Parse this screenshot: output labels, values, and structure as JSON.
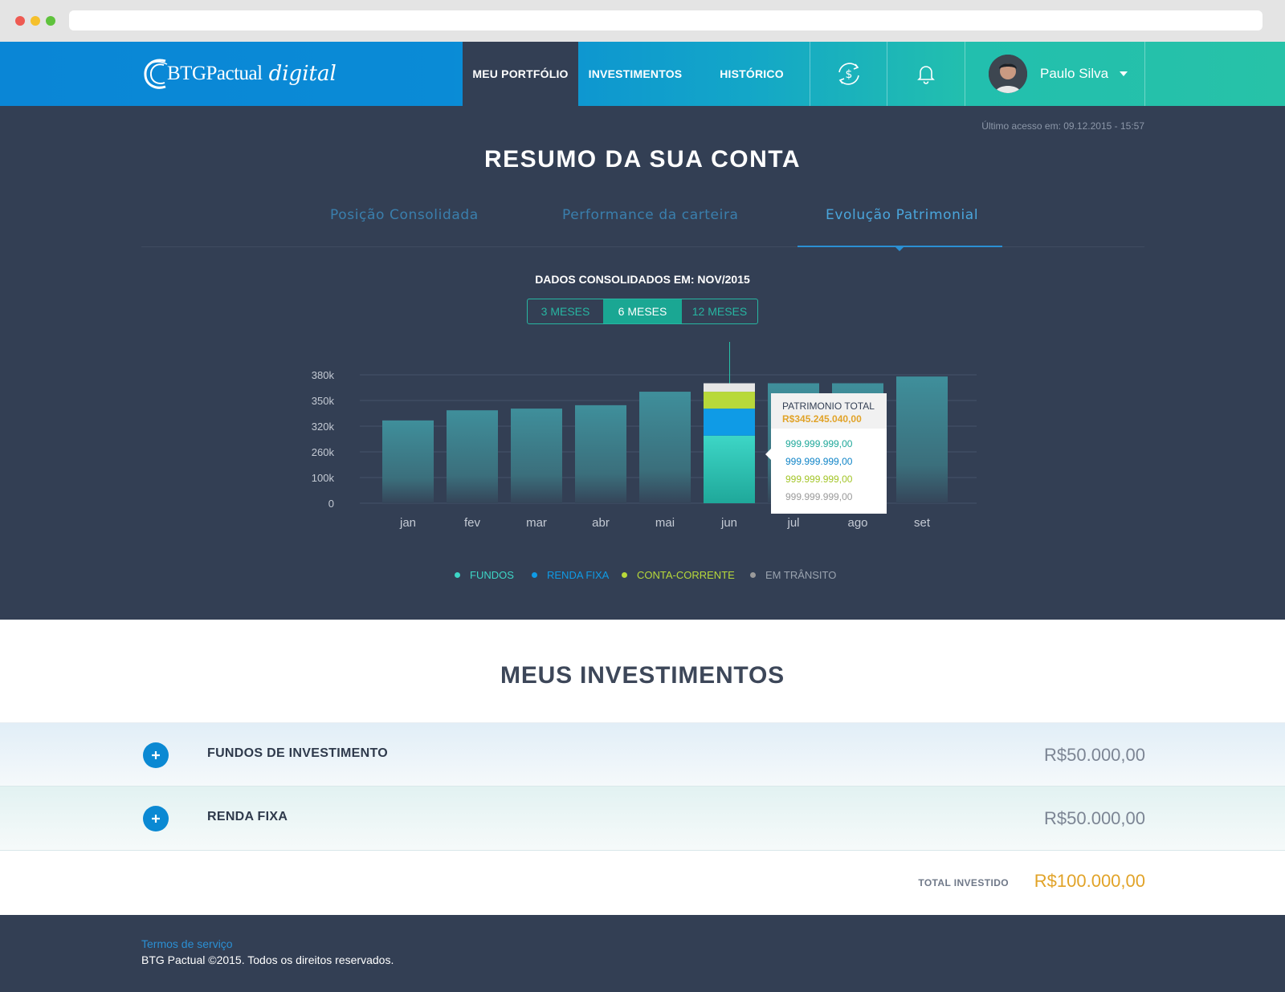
{
  "header": {
    "logo_text": "BTGPactual",
    "logo_script": "digital",
    "nav": [
      {
        "label": "MEU PORTFÓLIO",
        "active": true
      },
      {
        "label": "INVESTIMENTOS",
        "active": false
      },
      {
        "label": "HISTÓRICO",
        "active": false
      }
    ],
    "icons": [
      "money-cycle-icon",
      "bell-icon"
    ],
    "user_name": "Paulo Silva"
  },
  "summary": {
    "last_access": "Último acesso em: 09.12.2015 - 15:57",
    "title": "RESUMO DA SUA CONTA",
    "tabs": [
      {
        "label": "Posição Consolidada",
        "active": false
      },
      {
        "label": "Performance da carteira",
        "active": false
      },
      {
        "label": "Evolução Patrimonial",
        "active": true
      }
    ],
    "data_caption": "DADOS CONSOLIDADOS EM: NOV/2015",
    "periods": [
      {
        "label": "3 MESES",
        "active": false
      },
      {
        "label": "6 MESES",
        "active": true
      },
      {
        "label": "12 MESES",
        "active": false
      }
    ]
  },
  "chart_data": {
    "type": "bar",
    "categories": [
      "jan",
      "fev",
      "mar",
      "abr",
      "mai",
      "jun",
      "jul",
      "ago",
      "set"
    ],
    "y_tick_labels": [
      "0",
      "100k",
      "260k",
      "320k",
      "350k",
      "380k"
    ],
    "values": [
      245,
      275,
      280,
      290,
      330,
      355,
      355,
      355,
      375
    ],
    "highlighted_category": "jun",
    "highlighted_stack": [
      {
        "series": "FUNDOS",
        "value": 200
      },
      {
        "series": "RENDA FIXA",
        "value": 80
      },
      {
        "series": "CONTA-CORRENTE",
        "value": 50
      },
      {
        "series": "EM TRÂNSITO",
        "value": 25
      }
    ],
    "grid": true,
    "legend_position": "bottom",
    "tooltip": {
      "title": "PATRIMONIO TOTAL",
      "total": "R$345.245.040,00",
      "rows": [
        "999.999.999,00",
        "999.999.999,00",
        "999.999.999,00",
        "999.999.999,00"
      ]
    },
    "legend": [
      {
        "name": "FUNDOS",
        "color": "#3dd6c6"
      },
      {
        "name": "RENDA FIXA",
        "color": "#0f9be6"
      },
      {
        "name": "CONTA-CORRENTE",
        "color": "#b8d93a"
      },
      {
        "name": "EM TRÂNSITO",
        "color": "#9a9a9a"
      }
    ],
    "colors": {
      "bar": "#3f8c98",
      "fundos": "#3dd6c6",
      "renda_fixa": "#0f9be6",
      "conta_corrente": "#b8d93a",
      "em_transito": "#e6e6e6"
    }
  },
  "investments": {
    "title": "MEUS INVESTIMENTOS",
    "rows": [
      {
        "label": "FUNDOS DE INVESTIMENTO",
        "value": "R$50.000,00"
      },
      {
        "label": "RENDA FIXA",
        "value": "R$50.000,00"
      }
    ],
    "total_label": "TOTAL INVESTIDO",
    "total_value": "R$100.000,00"
  },
  "footer": {
    "terms": "Termos de serviço",
    "copyright": "BTG Pactual ©2015. Todos os direitos reservados."
  }
}
